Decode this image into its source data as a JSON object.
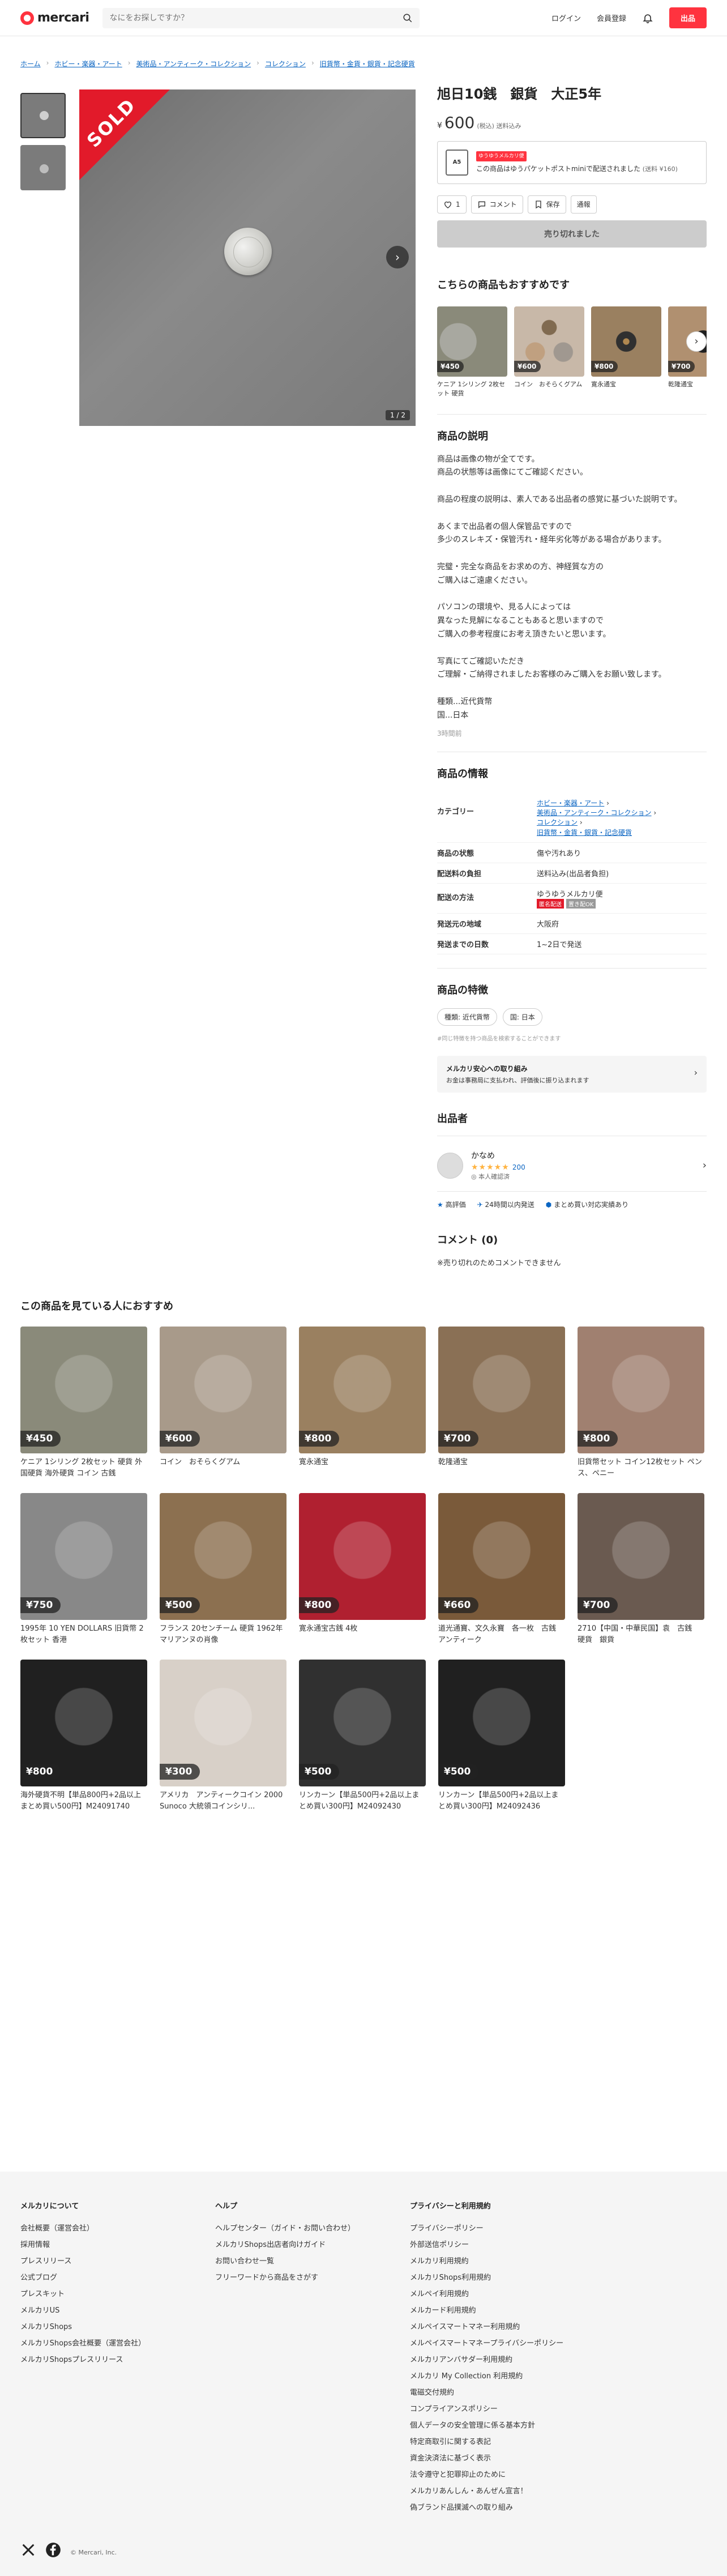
{
  "header": {
    "logo_text": "mercari",
    "search_placeholder": "なにをお探しですか？",
    "login": "ログイン",
    "signup": "会員登録",
    "sell": "出品"
  },
  "breadcrumb": [
    "ホーム",
    "ホビー・楽器・アート",
    "美術品・アンティーク・コレクション",
    "コレクション",
    "旧貨幣・金貨・銀貨・記念硬貨"
  ],
  "gallery": {
    "sold_label": "SOLD",
    "counter": "1 / 2"
  },
  "item": {
    "title": "旭日10銭　銀貨　大正5年",
    "price_yen": "¥",
    "price": "600",
    "price_note": "(税込) 送料込み",
    "ship_badge": "ゆうゆうメルカリ便",
    "ship_icon_label": "A5",
    "ship_text": "この商品はゆうパケットポストminiで配送されました",
    "ship_sub": "(送料 ¥160)",
    "likes": "1",
    "comment_label": "コメント",
    "save_label": "保存",
    "report_label": "通報",
    "soldout_label": "売り切れました"
  },
  "recommend": {
    "title": "こちらの商品もおすすめです",
    "items": [
      {
        "price": "¥450",
        "name": "ケニア 1シリング 2枚セット 硬貨",
        "color": "#8a8a7a"
      },
      {
        "price": "¥600",
        "name": "コイン　おそらくグアム",
        "color": "#a89a8a"
      },
      {
        "price": "¥800",
        "name": "寛永通宝",
        "color": "#9a8060"
      },
      {
        "price": "¥700",
        "name": "乾隆通宝",
        "color": "#8a7055"
      }
    ]
  },
  "description": {
    "title": "商品の説明",
    "text": "商品は画像の物が全てです。\n商品の状態等は画像にてご確認ください。\n\n商品の程度の説明は、素人である出品者の感覚に基づいた説明です。\n\nあくまで出品者の個人保管品ですので\n多少のスレキズ・保管汚れ・経年劣化等がある場合があります。\n\n完璧・完全な商品をお求めの方、神経質な方の\nご購入はご遠慮ください。\n\nパソコンの環境や、見る人によっては\n異なった見解になることもあると思いますので\nご購入の参考程度にお考え頂きたいと思います。\n\n写真にてご確認いただき\nご理解・ご納得されましたお客様のみご購入をお願い致します。\n\n種類...近代貨幣\n国...日本",
    "time_ago": "3時間前"
  },
  "info": {
    "title": "商品の情報",
    "rows": {
      "category_label": "カテゴリー",
      "category": [
        "ホビー・楽器・アート",
        "美術品・アンティーク・コレクション",
        "コレクション",
        "旧貨幣・金貨・銀貨・記念硬貨"
      ],
      "condition_label": "商品の状態",
      "condition": "傷や汚れあり",
      "shipping_fee_label": "配送料の負担",
      "shipping_fee": "送料込み(出品者負担)",
      "method_label": "配送の方法",
      "method": "ゆうゆうメルカリ便",
      "method_tag1": "匿名配送",
      "method_tag2": "置き配OK",
      "region_label": "発送元の地域",
      "region": "大阪府",
      "days_label": "発送までの日数",
      "days": "1~2日で発送"
    }
  },
  "features": {
    "title": "商品の特徴",
    "chips": [
      "種類: 近代貨幣",
      "国: 日本"
    ],
    "note": "#同じ特徴を持つ商品を検索することができます",
    "safe_title": "メルカリ安心への取り組み",
    "safe_text": "お金は事務局に支払われ、評価後に振り込まれます"
  },
  "seller": {
    "title": "出品者",
    "name": "かなめ",
    "stars": "★★★★★",
    "count": "200",
    "verified": "本人確認済",
    "badge1": "高評価",
    "badge2": "24時間以内発送",
    "badge3": "まとめ買い対応実績あり"
  },
  "comments": {
    "title": "コメント (0)",
    "note": "※売り切れのためコメントできません"
  },
  "lower": {
    "title": "この商品を見ている人におすすめ",
    "items": [
      {
        "price": "¥450",
        "name": "ケニア 1シリング 2枚セット 硬貨 外国硬貨 海外硬貨 コイン 古銭",
        "color": "#8a8a7a"
      },
      {
        "price": "¥600",
        "name": "コイン　おそらくグアム",
        "color": "#a89a8a"
      },
      {
        "price": "¥800",
        "name": "寛永通宝",
        "color": "#9a8060"
      },
      {
        "price": "¥700",
        "name": "乾隆通宝",
        "color": "#8a7055"
      },
      {
        "price": "¥800",
        "name": "旧貨幣セット コイン12枚セット ペンス、ペニー",
        "color": "#a08070"
      },
      {
        "price": "¥750",
        "name": "1995年 10 YEN DOLLARS 旧貨幣 2枚セット 香港",
        "color": "#888"
      },
      {
        "price": "¥500",
        "name": "フランス 20センチーム 硬貨 1962年 マリアンヌの肖像",
        "color": "#8c7050"
      },
      {
        "price": "¥800",
        "name": "寛永通宝古銭 4枚",
        "color": "#b02030"
      },
      {
        "price": "¥660",
        "name": "道光通寶、文久永寶　各一枚　古銭　アンティーク",
        "color": "#7a5a3a"
      },
      {
        "price": "¥700",
        "name": "2710【中国・中華民国】袁　古銭　硬貨　銀貨",
        "color": "#6a5a50"
      },
      {
        "price": "¥800",
        "name": "海外硬貨不明【単品800円+2品以上まとめ買い500円】M24091740",
        "color": "#202020"
      },
      {
        "price": "¥300",
        "name": "アメリカ　アンティークコイン 2000 Sunoco 大統領コインシリ...",
        "color": "#d8d0c8"
      },
      {
        "price": "¥500",
        "name": "リンカーン【単品500円+2品以上まとめ買い300円】M24092430",
        "color": "#303030"
      },
      {
        "price": "¥500",
        "name": "リンカーン【単品500円+2品以上まとめ買い300円】M24092436",
        "color": "#202020"
      }
    ]
  },
  "footer": {
    "col1": {
      "title": "メルカリについて",
      "links": [
        "会社概要（運営会社）",
        "採用情報",
        "プレスリリース",
        "公式ブログ",
        "プレスキット",
        "メルカリUS",
        "メルカリShops",
        "メルカリShops会社概要（運営会社）",
        "メルカリShopsプレスリリース"
      ]
    },
    "col2": {
      "title": "ヘルプ",
      "links": [
        "ヘルプセンター（ガイド・お問い合わせ）",
        "メルカリShops出店者向けガイド",
        "お問い合わせ一覧",
        "フリーワードから商品をさがす"
      ]
    },
    "col3": {
      "title": "プライバシーと利用規約",
      "links": [
        "プライバシーポリシー",
        "外部送信ポリシー",
        "メルカリ利用規約",
        "メルカリShops利用規約",
        "メルペイ利用規約",
        "メルカード利用規約",
        "メルペイスマートマネー利用規約",
        "メルペイスマートマネープライバシーポリシー",
        "メルカリアンバサダー利用規約",
        "メルカリ My Collection 利用規約",
        "電磁交付規約",
        "コンプライアンスポリシー",
        "個人データの安全管理に係る基本方針",
        "特定商取引に関する表記",
        "資金決済法に基づく表示",
        "法令遵守と犯罪抑止のために",
        "メルカリあんしん・あんぜん宣言！",
        "偽ブランド品撲滅への取り組み"
      ]
    },
    "copyright": "© Mercari, Inc."
  }
}
